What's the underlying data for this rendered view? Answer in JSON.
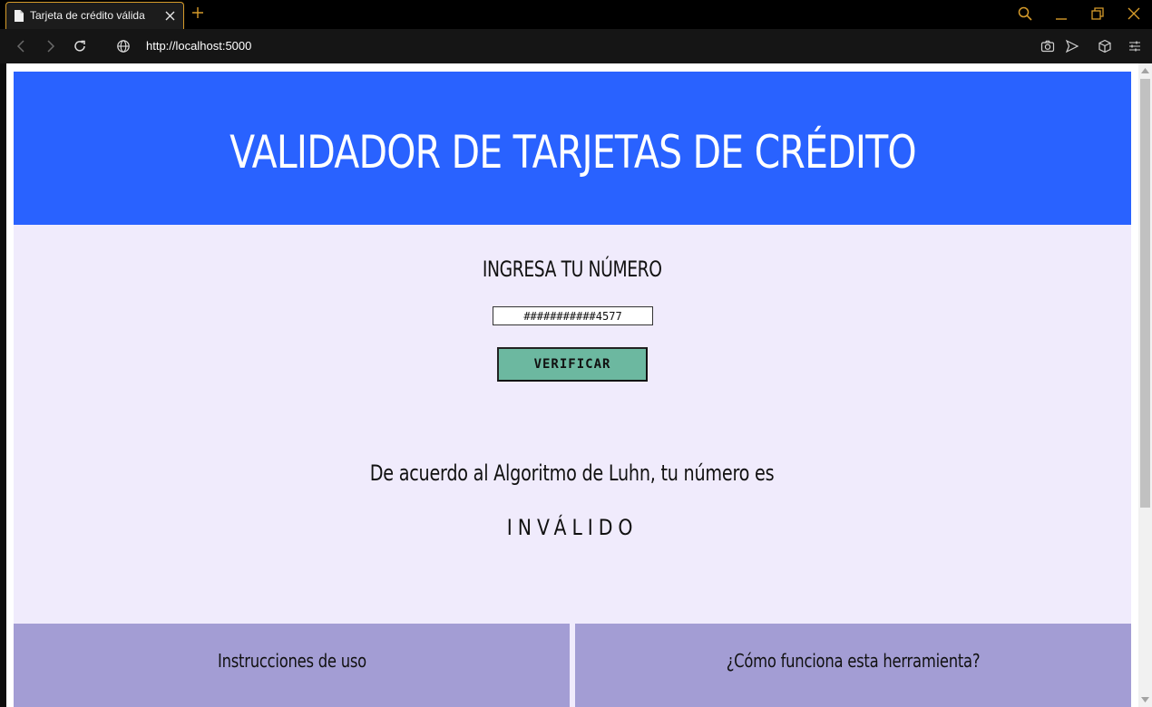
{
  "browser": {
    "tab_title": "Tarjeta de crédito válida",
    "url": "http://localhost:5000",
    "accent_color": "#d69b2a"
  },
  "page": {
    "header_title": "VALIDADOR DE TARJETAS DE CRÉDITO",
    "form_title": "INGRESA TU NÚMERO",
    "card_number_value": "###########4577",
    "verify_label": "VERIFICAR",
    "result_text": "De acuerdo al Algoritmo de Luhn, tu número es",
    "result_status": "INVÁLIDO",
    "info_boxes": [
      {
        "label": "Instrucciones de uso"
      },
      {
        "label": "¿Cómo funciona esta herramienta?"
      }
    ],
    "colors": {
      "header": "#2962ff",
      "background": "#f0ebfc",
      "button": "#6cb8a0",
      "info_box": "#a39dd4"
    }
  }
}
